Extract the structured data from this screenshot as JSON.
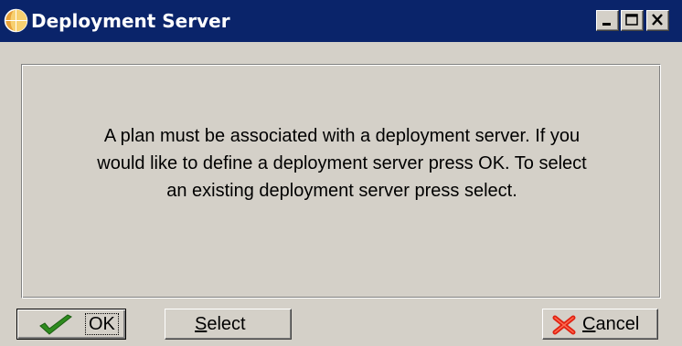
{
  "window": {
    "title": "Deployment Server",
    "controls": {
      "minimize": "minimize-icon",
      "maximize": "maximize-icon",
      "close": "close-icon"
    }
  },
  "message": {
    "lines": [
      "A plan must be associated with a deployment server. If you",
      "would like to define a deployment server press OK.  To select",
      "an existing deployment server press select."
    ]
  },
  "buttons": {
    "ok": {
      "label": "OK",
      "icon": "checkmark-icon"
    },
    "select": {
      "mnemonic": "S",
      "rest": "elect"
    },
    "cancel": {
      "mnemonic": "C",
      "rest": "ancel",
      "icon": "red-x-icon"
    }
  },
  "colors": {
    "titlebar": "#0a246a",
    "face": "#d4d0c8",
    "checkmark": "#2e8b1e",
    "cancel_x": "#e02010"
  }
}
